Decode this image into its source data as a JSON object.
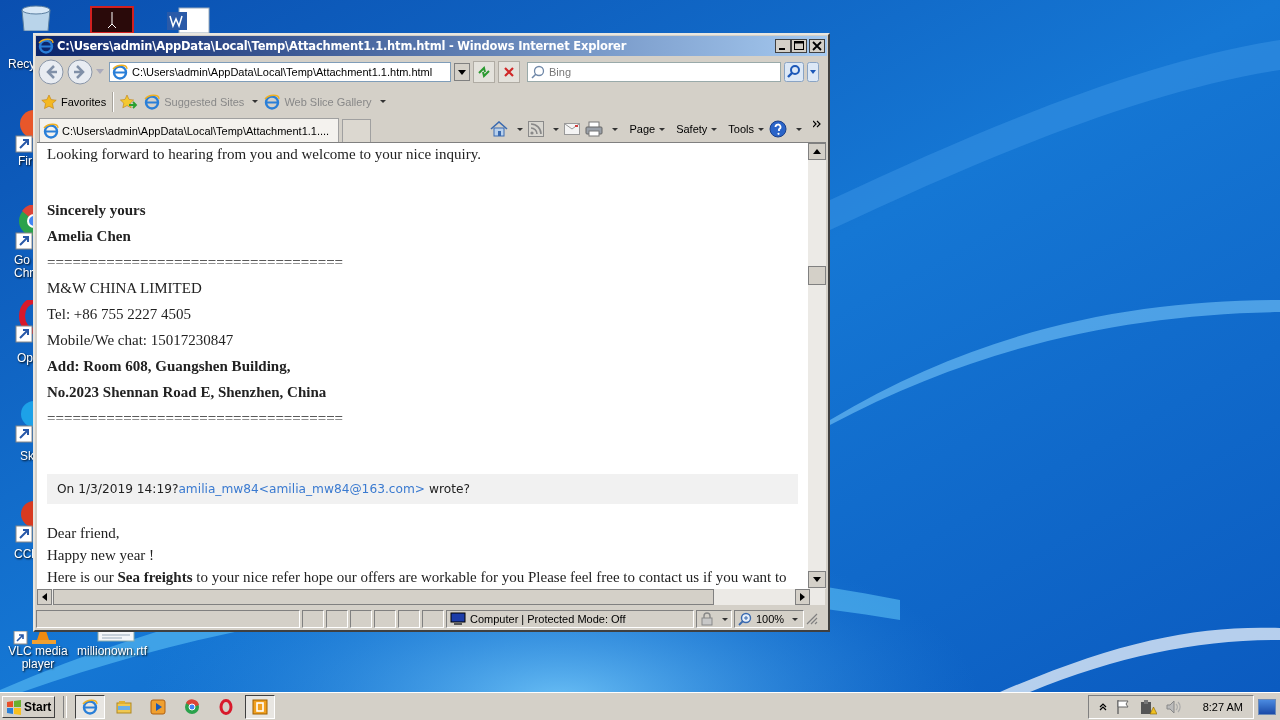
{
  "desktop": {
    "icons": [
      {
        "kind": "recycle-bin",
        "label_lines": [
          "Recy"
        ]
      },
      {
        "kind": "pdf"
      },
      {
        "kind": "word"
      },
      {
        "kind": "firefox",
        "label_lines": [
          "Fir"
        ]
      },
      {
        "kind": "chrome",
        "label_lines": [
          "Go",
          "Chr"
        ]
      },
      {
        "kind": "opera",
        "label_lines": [
          "Op"
        ]
      },
      {
        "kind": "skype",
        "label_lines": [
          "Sk"
        ]
      },
      {
        "kind": "ccleaner",
        "label_lines": [
          "CCl"
        ]
      },
      {
        "kind": "vlc",
        "label_lines": [
          "VLC media",
          "player"
        ]
      },
      {
        "kind": "document",
        "label_lines": [
          "millionown.rtf"
        ]
      }
    ]
  },
  "window": {
    "title": "C:\\Users\\admin\\AppData\\Local\\Temp\\Attachment1.1.htm.html - Windows Internet Explorer",
    "address": "C:\\Users\\admin\\AppData\\Local\\Temp\\Attachment1.1.htm.html",
    "search": {
      "placeholder": "Bing"
    },
    "favorites_bar": [
      {
        "kind": "favorites",
        "label": "Favorites"
      },
      {
        "kind": "link",
        "label": "Suggested Sites"
      },
      {
        "kind": "link",
        "label": "Web Slice Gallery"
      }
    ],
    "tabs": [
      {
        "label": "C:\\Users\\admin\\AppData\\Local\\Temp\\Attachment1.1....",
        "selected": true
      }
    ],
    "command_bar": [
      {
        "kind": "home"
      },
      {
        "kind": "feeds"
      },
      {
        "kind": "mail"
      },
      {
        "kind": "print"
      },
      {
        "kind": "menu",
        "label": "Page"
      },
      {
        "kind": "menu",
        "label": "Safety"
      },
      {
        "kind": "menu",
        "label": "Tools"
      },
      {
        "kind": "help"
      }
    ],
    "status_bar": {
      "zone": "Computer | Protected Mode: Off",
      "zoom": "100%"
    }
  },
  "page": {
    "intro": "Looking forward to hearing from you and welcome to your nice inquiry.",
    "signature": [
      {
        "text": "Sincerely yours",
        "bold": true
      },
      {
        "text": "Amelia Chen",
        "bold": true
      },
      {
        "text": "===================================",
        "bold": false
      },
      {
        "text": "M&W CHINA LIMITED",
        "bold": false
      },
      {
        "text": "Tel: +86 755 2227 4505",
        "bold": false
      },
      {
        "text": "Mobile/We chat: 15017230847",
        "bold": false
      },
      {
        "text": "Add: Room 608, Guangshen Building,",
        "bold": true
      },
      {
        "text": "No.2023 Shennan Road E, Shenzhen, China",
        "bold": true
      },
      {
        "text": "===================================",
        "bold": false
      }
    ],
    "quote_header": {
      "prefix": "On 1/3/2019 14:19?",
      "link": "amilia_mw84<amilia_mw84@163.com>",
      "suffix": "wrote?"
    },
    "quoted": [
      "Dear friend,",
      "Happy new year !",
      "Here is our **Sea freights** to your nice refer hope our offers are workable for you Please feel free to contact us if you want to"
    ]
  },
  "taskbar": {
    "start": "Start",
    "apps": [
      {
        "kind": "ie",
        "selected": true
      },
      {
        "kind": "explorer",
        "selected": false
      },
      {
        "kind": "media",
        "selected": false
      },
      {
        "kind": "chrome",
        "selected": false
      },
      {
        "kind": "opera",
        "selected": false
      },
      {
        "kind": "box",
        "selected": true
      }
    ],
    "clock": "8:27 AM"
  }
}
